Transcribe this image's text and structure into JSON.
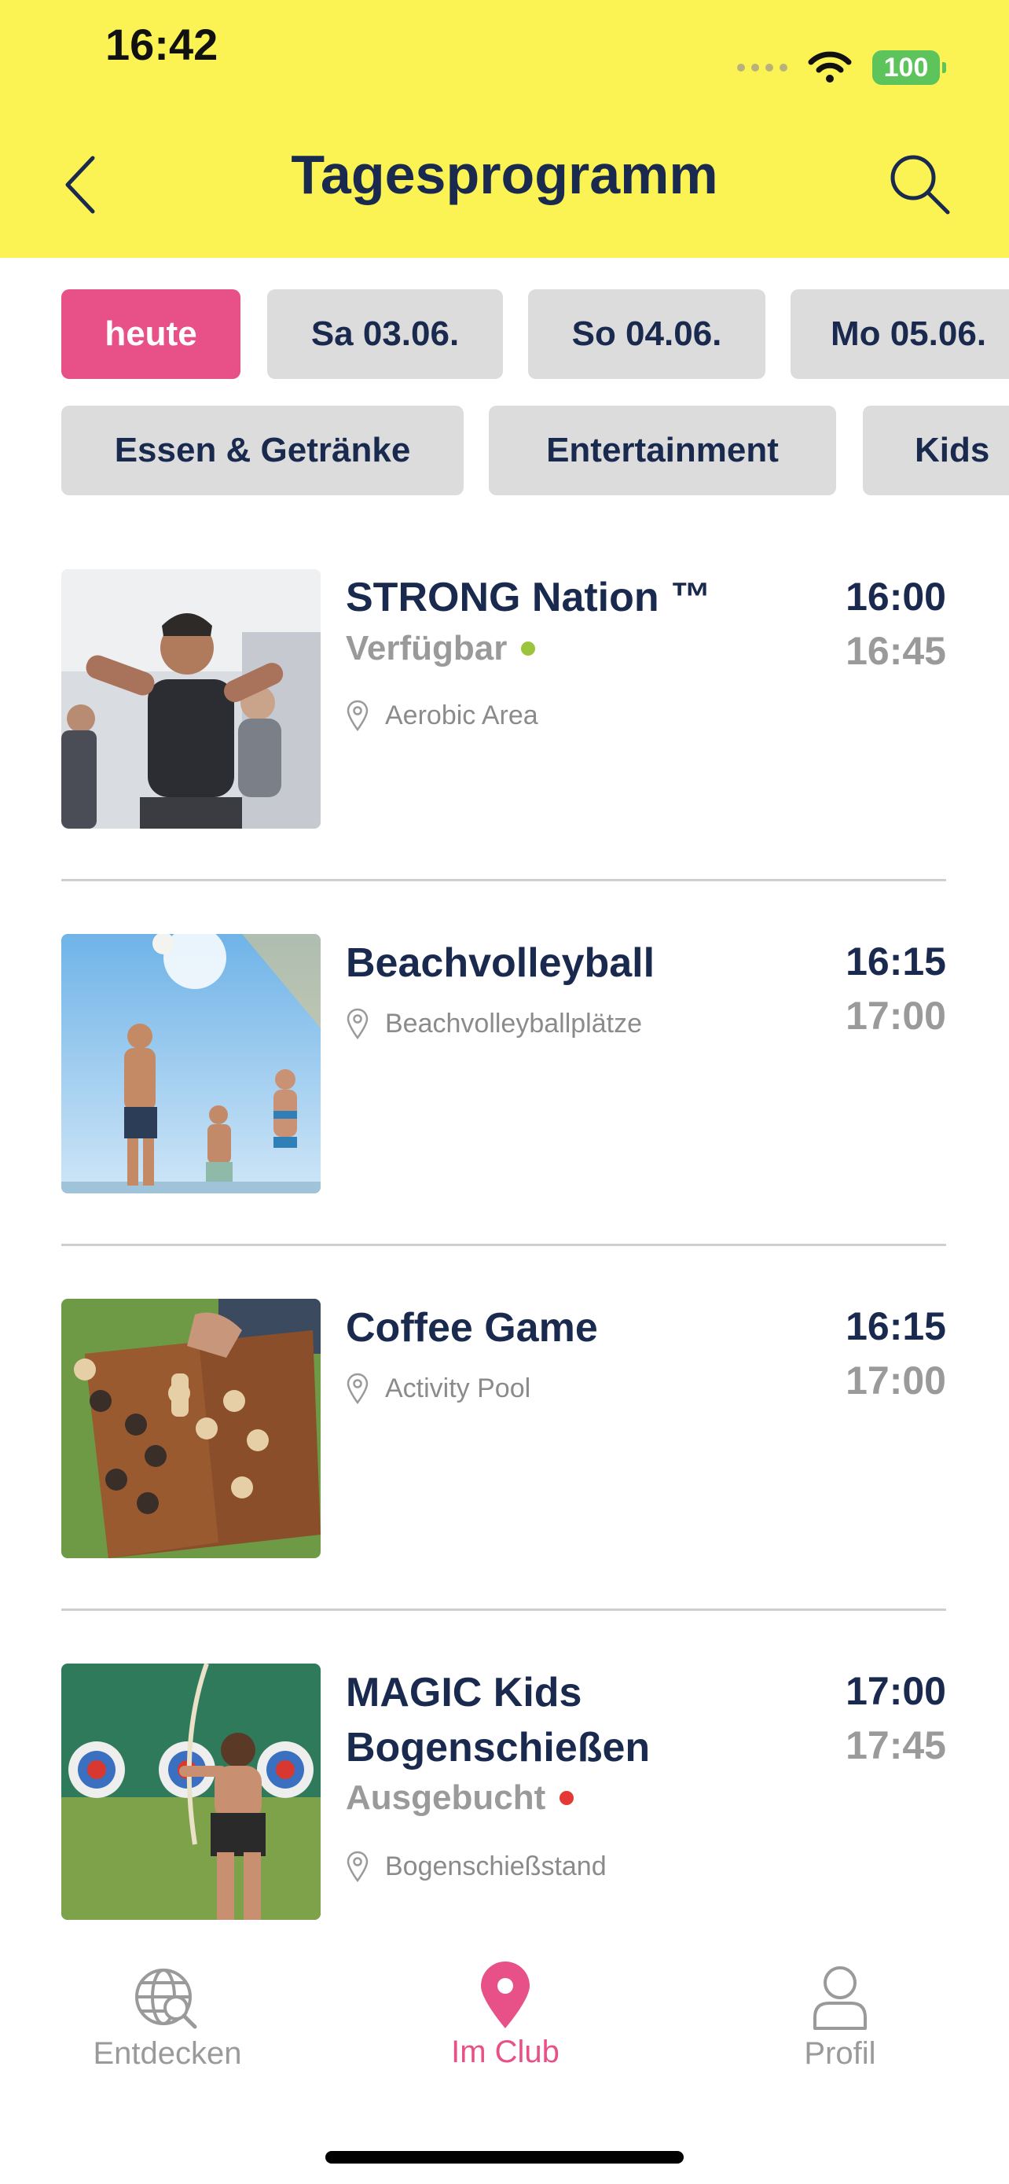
{
  "status_bar": {
    "time": "16:42",
    "battery": "100"
  },
  "header": {
    "title": "Tagesprogramm"
  },
  "date_chips": [
    {
      "label": "heute",
      "active": true
    },
    {
      "label": "Sa 03.06.",
      "active": false
    },
    {
      "label": "So 04.06.",
      "active": false
    },
    {
      "label": "Mo 05.06.",
      "active": false
    }
  ],
  "category_chips": [
    {
      "label": "Essen & Getränke"
    },
    {
      "label": "Entertainment"
    },
    {
      "label": "Kids"
    }
  ],
  "events": [
    {
      "title": "STRONG Nation ™",
      "status": "Verfügbar",
      "status_color": "#9bc53d",
      "location": "Aerobic Area",
      "start": "16:00",
      "end": "16:45"
    },
    {
      "title": "Beachvolleyball",
      "status": "",
      "location": "Beachvolleyballplätze",
      "start": "16:15",
      "end": "17:00"
    },
    {
      "title": "Coffee Game",
      "status": "",
      "location": "Activity Pool",
      "start": "16:15",
      "end": "17:00"
    },
    {
      "title": "MAGIC Kids Bogenschießen",
      "status": "Ausgebucht",
      "status_color": "#e53935",
      "location": "Bogenschießstand",
      "start": "17:00",
      "end": "17:45"
    }
  ],
  "tabbar": {
    "items": [
      {
        "label": "Entdecken",
        "icon": "globe-search-icon",
        "active": false
      },
      {
        "label": "Im Club",
        "icon": "location-pin-icon",
        "active": true
      },
      {
        "label": "Profil",
        "icon": "person-icon",
        "active": false
      }
    ]
  },
  "colors": {
    "header_bg": "#fbf353",
    "accent": "#e85088",
    "navy": "#1a2a4f",
    "chip_bg": "#dcdcdc"
  }
}
